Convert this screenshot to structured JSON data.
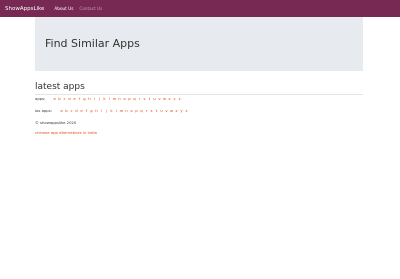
{
  "navbar": {
    "brand": "ShowAppsLike",
    "links": [
      "About Us",
      "Contact Us"
    ]
  },
  "jumbotron": {
    "title": "Find Similar Apps"
  },
  "latest": {
    "title": "latest apps"
  },
  "apps_row": {
    "label": "apps:",
    "letters": [
      "a",
      "b",
      "c",
      "d",
      "e",
      "f",
      "g",
      "h",
      "i",
      "j",
      "k",
      "l",
      "m",
      "n",
      "o",
      "p",
      "q",
      "r",
      "s",
      "t",
      "u",
      "v",
      "w",
      "x",
      "y",
      "z"
    ]
  },
  "ios_row": {
    "label": "ios apps:",
    "letters": [
      "a",
      "b",
      "c",
      "d",
      "e",
      "f",
      "g",
      "h",
      "i",
      "j",
      "k",
      "l",
      "m",
      "n",
      "o",
      "p",
      "q",
      "r",
      "s",
      "t",
      "u",
      "v",
      "w",
      "x",
      "y",
      "z"
    ]
  },
  "footer": {
    "copyright": "© showappslike 2020",
    "link": "chinese app alternatives in india"
  },
  "colors": {
    "navbar_bg": "#772953",
    "link": "#dd4814",
    "jumbotron_bg": "#e7eaee"
  }
}
